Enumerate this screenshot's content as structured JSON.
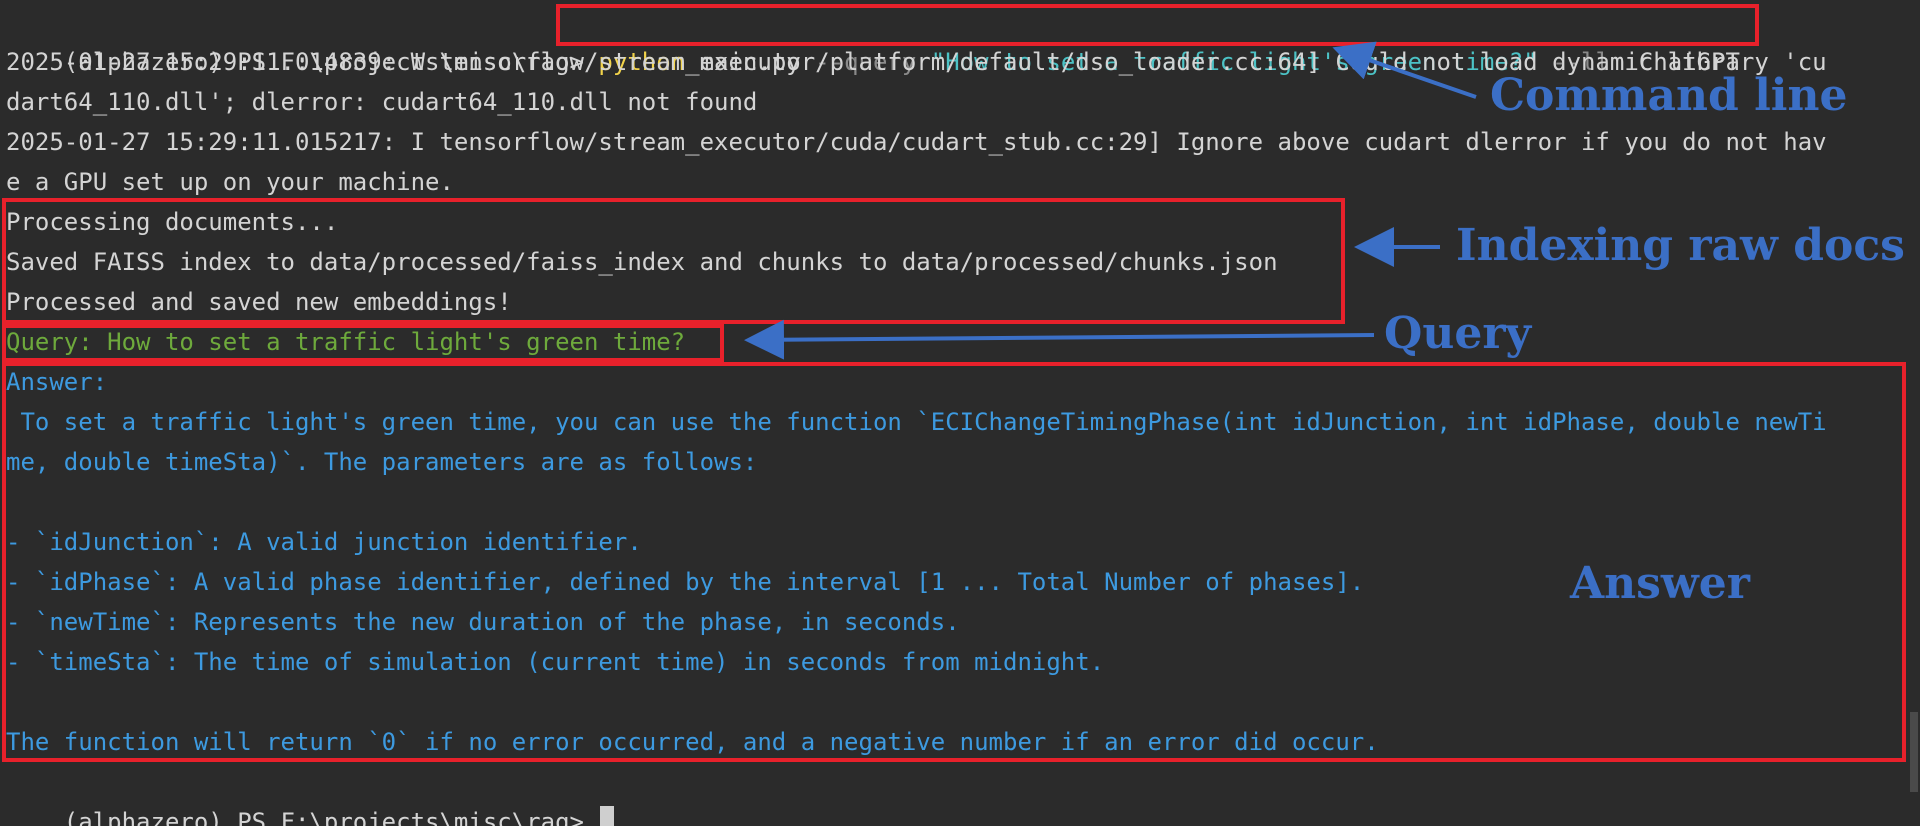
{
  "terminal": {
    "prompt": "(alphazero) PS F:\\projects\\misc\\rag> ",
    "command": {
      "exe": "python",
      "script": " main.py ",
      "flag_query": "--query",
      "query_value": " \"How to set a traffic light's green time?\"",
      "flag_llm": " --llm",
      "llm_value": " ChatGPT"
    },
    "log_lines": [
      "2025-01-27 15:29:11.014839: W tensorflow/stream_executor/platform/default/dso_loader.cc:64] Could not load dynamic library 'cu",
      "dart64_110.dll'; dlerror: cudart64_110.dll not found",
      "2025-01-27 15:29:11.015217: I tensorflow/stream_executor/cuda/cudart_stub.cc:29] Ignore above cudart dlerror if you do not hav",
      "e a GPU set up on your machine."
    ],
    "index_lines": [
      "Processing documents...",
      "Saved FAISS index to data/processed/faiss_index and chunks to data/processed/chunks.json",
      "Processed and saved new embeddings!"
    ],
    "query_line": "Query: How to set a traffic light's green time?",
    "answer_lines": [
      "Answer:",
      " To set a traffic light's green time, you can use the function `ECIChangeTimingPhase(int idJunction, int idPhase, double newTi",
      "me, double timeSta)`. The parameters are as follows:",
      "",
      "- `idJunction`: A valid junction identifier.",
      "- `idPhase`: A valid phase identifier, defined by the interval [1 ... Total Number of phases].",
      "- `newTime`: Represents the new duration of the phase, in seconds.",
      "- `timeSta`: The time of simulation (current time) in seconds from midnight.",
      "",
      "The function will return `0` if no error occurred, and a negative number if an error did occur."
    ],
    "final_prompt": "(alphazero) PS F:\\projects\\misc\\rag> "
  },
  "annotations": {
    "command_line": "Command line",
    "indexing": "Indexing raw docs",
    "query": "Query",
    "answer": "Answer"
  },
  "colors": {
    "background": "#2b2b2b",
    "highlight_box": "#e8212b",
    "annotation": "#3b6fc6",
    "answer_text": "#3d9ae0",
    "query_text": "#6eaa3c"
  }
}
